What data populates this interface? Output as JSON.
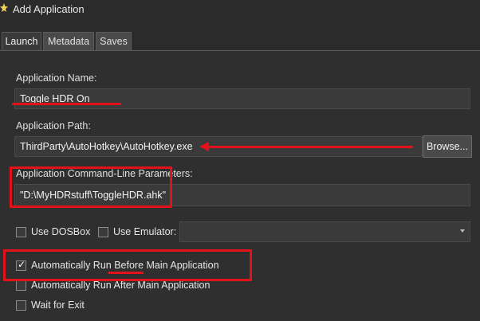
{
  "window": {
    "title": "Add Application",
    "app_icon": "star-icon"
  },
  "tabs": [
    {
      "label": "Launch",
      "active": true
    },
    {
      "label": "Metadata",
      "active": false
    },
    {
      "label": "Saves",
      "active": false
    }
  ],
  "form": {
    "name_label": "Application Name:",
    "name_value": "Toggle HDR On",
    "path_label": "Application Path:",
    "path_value": "ThirdParty\\AutoHotkey\\AutoHotkey.exe",
    "browse_label": "Browse...",
    "params_label": "Application Command-Line Parameters:",
    "params_value": "\"D:\\MyHDRstuff\\ToggleHDR.ahk\"",
    "dosbox_label": "Use DOSBox",
    "emulator_label": "Use Emulator:",
    "emulator_value": "",
    "options": [
      {
        "label": "Automatically Run Before Main Application",
        "checked": true
      },
      {
        "label": "Automatically Run After Main Application",
        "checked": false
      },
      {
        "label": "Wait for Exit",
        "checked": false
      }
    ]
  },
  "colors": {
    "annotation": "#e3111a",
    "background": "#2f2f2f",
    "field": "#3a3a3a"
  }
}
